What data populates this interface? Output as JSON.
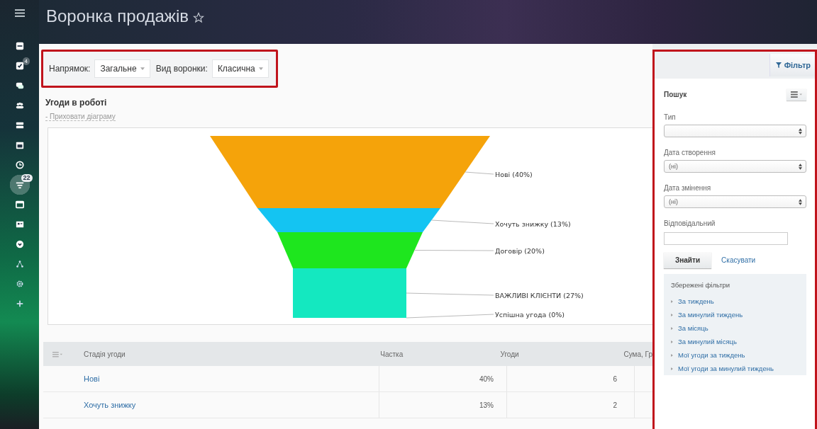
{
  "header": {
    "title": "Воронка продажів"
  },
  "sidebar": {
    "items": [
      {
        "selected": false
      },
      {
        "selected": false,
        "badge": "4"
      },
      {
        "selected": false
      },
      {
        "selected": false
      },
      {
        "selected": false
      },
      {
        "selected": false
      },
      {
        "selected": false
      },
      {
        "selected": true,
        "badge": "22"
      },
      {
        "selected": false
      },
      {
        "selected": false
      },
      {
        "selected": false
      },
      {
        "selected": false
      },
      {
        "selected": false
      },
      {
        "selected": false
      }
    ]
  },
  "toolbar": {
    "fields": [
      {
        "label": "Напрямок:",
        "value": "Загальне"
      },
      {
        "label": "Вид воронки:",
        "value": "Класична"
      }
    ]
  },
  "section": {
    "title": "Угоди в роботі",
    "toggle": "- Приховати діаграму"
  },
  "funnel": {
    "stages": [
      {
        "label": "Нові (40%)",
        "color": "#f5a30a"
      },
      {
        "label": "Хочуть знижку (13%)",
        "color": "#14c4f2"
      },
      {
        "label": "Договір (20%)",
        "color": "#1ee61e"
      },
      {
        "label": "ВАЖЛИВІ КЛІЄНТИ (27%)",
        "color": "#14e8c0"
      },
      {
        "label": "Успішна угода (0%)"
      }
    ]
  },
  "table": {
    "columns": [
      "Стадія угоди",
      "Частка",
      "Угоди",
      "Сума, Гр"
    ],
    "rows": [
      {
        "stage": "Нові",
        "share": "40%",
        "deals": "6"
      },
      {
        "stage": "Хочуть знижку",
        "share": "13%",
        "deals": "2"
      }
    ]
  },
  "filter": {
    "button": "Фільтр",
    "search_title": "Пошук",
    "fields": [
      {
        "kind": "select",
        "label": "Тип"
      },
      {
        "kind": "select",
        "label": "Дата створення",
        "value": "(ні)"
      },
      {
        "kind": "select",
        "label": "Дата змінення",
        "value": "(ні)"
      },
      {
        "kind": "input",
        "label": "Відповідальний"
      }
    ],
    "find": "Знайти",
    "cancel": "Скасувати",
    "saved": {
      "title": "Збережені фільтри",
      "items": [
        "За тиждень",
        "За минулий тиждень",
        "За місяць",
        "За минулий місяць",
        "Мої угоди за тиждень",
        "Мої угоди за минулий тиждень"
      ]
    }
  }
}
